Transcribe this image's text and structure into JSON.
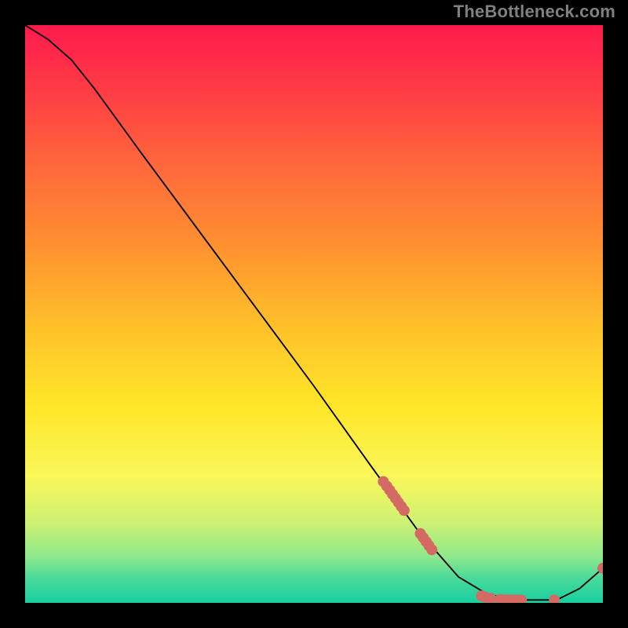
{
  "title": "TheBottleneck.com",
  "colors": {
    "dot": "#d46a63",
    "line": "#000000"
  },
  "chart_data": {
    "type": "line",
    "title": "TheBottleneck.com",
    "xlabel": "",
    "ylabel": "",
    "xlim": [
      0,
      100
    ],
    "ylim": [
      0,
      100
    ],
    "grid": false,
    "legend": false,
    "line_points": [
      {
        "x": 0,
        "y": 100
      },
      {
        "x": 4,
        "y": 97.5
      },
      {
        "x": 8,
        "y": 94
      },
      {
        "x": 12,
        "y": 89
      },
      {
        "x": 20,
        "y": 78
      },
      {
        "x": 30,
        "y": 64.5
      },
      {
        "x": 40,
        "y": 51
      },
      {
        "x": 50,
        "y": 37.5
      },
      {
        "x": 60,
        "y": 23.5
      },
      {
        "x": 68,
        "y": 12.5
      },
      {
        "x": 75,
        "y": 4.5
      },
      {
        "x": 80,
        "y": 1.5
      },
      {
        "x": 85,
        "y": 0.5
      },
      {
        "x": 92,
        "y": 0.5
      },
      {
        "x": 96,
        "y": 2.5
      },
      {
        "x": 100,
        "y": 6
      }
    ],
    "data_points": [
      {
        "x": 62,
        "y": 21
      },
      {
        "x": 62.6,
        "y": 20.2
      },
      {
        "x": 63.1,
        "y": 19.5
      },
      {
        "x": 63.6,
        "y": 18.8
      },
      {
        "x": 64.1,
        "y": 18.1
      },
      {
        "x": 64.6,
        "y": 17.4
      },
      {
        "x": 65.1,
        "y": 16.7
      },
      {
        "x": 65.6,
        "y": 16
      },
      {
        "x": 68.4,
        "y": 12
      },
      {
        "x": 68.9,
        "y": 11.3
      },
      {
        "x": 69.4,
        "y": 10.6
      },
      {
        "x": 69.9,
        "y": 9.9
      },
      {
        "x": 70.4,
        "y": 9.2
      },
      {
        "x": 79,
        "y": 1.2
      },
      {
        "x": 79.6,
        "y": 1.0
      },
      {
        "x": 80.6,
        "y": 0.8
      },
      {
        "x": 82.2,
        "y": 0.6
      },
      {
        "x": 82.8,
        "y": 0.55
      },
      {
        "x": 83.5,
        "y": 0.5
      },
      {
        "x": 84.1,
        "y": 0.5
      },
      {
        "x": 84.7,
        "y": 0.5
      },
      {
        "x": 85.3,
        "y": 0.5
      },
      {
        "x": 85.9,
        "y": 0.5
      },
      {
        "x": 91.6,
        "y": 0.5
      },
      {
        "x": 100,
        "y": 6
      }
    ]
  }
}
